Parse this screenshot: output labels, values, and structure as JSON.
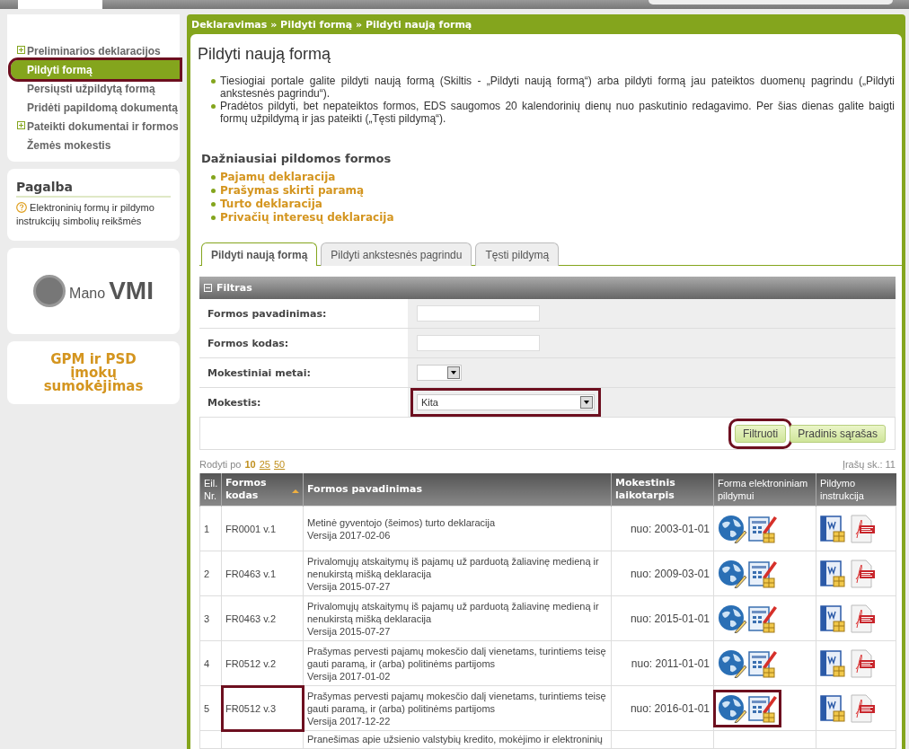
{
  "sidebar": {
    "menu": [
      {
        "label": "Preliminarios deklaracijos",
        "expandable": true,
        "selected": false,
        "marked": false
      },
      {
        "label": "Pildyti formą",
        "expandable": false,
        "selected": true,
        "marked": true
      },
      {
        "label": "Persiųsti užpildytą formą",
        "expandable": false,
        "selected": false,
        "marked": false
      },
      {
        "label": "Pridėti papildomą dokumentą",
        "expandable": false,
        "selected": false,
        "marked": false
      },
      {
        "label": "Pateikti dokumentai ir formos",
        "expandable": true,
        "selected": false,
        "marked": false
      },
      {
        "label": "Žemės mokestis",
        "expandable": false,
        "selected": false,
        "marked": false
      }
    ],
    "help": {
      "title": "Pagalba",
      "link": "Elektroninių formų ir pildymo instrukcijų simbolių reikšmės"
    },
    "logo": {
      "small": "Mano",
      "large": "VMI"
    },
    "promo": "GPM ir PSD įmokų sumokėjimas"
  },
  "breadcrumb": "Deklaravimas » Pildyti formą » Pildyti naują formą",
  "page_title": "Pildyti naują formą",
  "intro": [
    "Tiesiogiai portale galite pildyti naują formą (Skiltis - „Pildyti naują formą“) arba pildyti formą jau pateiktos duomenų pagrindu („Pildyti ankstesnės pagrindu“).",
    "Pradėtos pildyti, bet nepateiktos formos, EDS saugomos 20 kalendorinių dienų nuo paskutinio redagavimo. Per šias dienas galite baigti formų užpildymą ir jas pateikti („Tęsti pildymą“)."
  ],
  "frequent": {
    "title": "Dažniausiai pildomos formos",
    "links": [
      "Pajamų deklaracija",
      "Prašymas skirti paramą",
      "Turto deklaracija",
      "Privačių interesų deklaracija"
    ]
  },
  "tabs": [
    {
      "label": "Pildyti naują formą",
      "selected": true
    },
    {
      "label": "Pildyti ankstesnės pagrindu",
      "selected": false
    },
    {
      "label": "Tęsti pildymą",
      "selected": false
    }
  ],
  "filter": {
    "title": "Filtras",
    "expanded": true,
    "fields": [
      {
        "label": "Formos pavadinimas:",
        "kind": "text",
        "annotated": false
      },
      {
        "label": "Formos kodas:",
        "kind": "text",
        "annotated": false
      },
      {
        "label": "Mokestiniai metai:",
        "kind": "short-select",
        "annotated": false
      },
      {
        "label": "Mokestis:",
        "kind": "select",
        "value": "Kita",
        "annotated": true
      }
    ],
    "buttons": [
      {
        "label": "Filtruoti",
        "marked": true
      },
      {
        "label": "Pradinis sąrašas",
        "marked": false
      }
    ]
  },
  "paging": {
    "label": "Rodyti po",
    "sizes": [
      {
        "label": "10",
        "selected": true
      },
      {
        "label": "25",
        "selected": false
      },
      {
        "label": "50",
        "selected": false
      }
    ],
    "count": "Įrašų sk.: 11"
  },
  "table": {
    "columns": [
      {
        "label": "Eil. Nr.",
        "bold": false,
        "sorted": false
      },
      {
        "label": "Formos kodas",
        "bold": true,
        "sorted": true
      },
      {
        "label": "Formos pavadinimas",
        "bold": true,
        "sorted": false
      },
      {
        "label": "Mokestinis laikotarpis",
        "bold": true,
        "sorted": false
      },
      {
        "label": "Forma elektroniniam pildymui",
        "bold": false,
        "sorted": false
      },
      {
        "label": "Pildymo instrukcija",
        "bold": false,
        "sorted": false
      }
    ],
    "rows": [
      {
        "no": "1",
        "code": "FR0001 v.1",
        "name": "Metinė gyventojo (šeimos) turto deklaracija",
        "version": "Versija 2017-02-06",
        "period": "nuo: 2003-01-01",
        "code_marked": false,
        "icons_marked": false
      },
      {
        "no": "2",
        "code": "FR0463 v.1",
        "name": "Privalomųjų atskaitymų iš pajamų už parduotą žaliavinę medieną ir nenukirstą mišką deklaracija",
        "version": "Versija 2015-07-27",
        "period": "nuo: 2009-03-01",
        "code_marked": false,
        "icons_marked": false
      },
      {
        "no": "3",
        "code": "FR0463 v.2",
        "name": "Privalomųjų atskaitymų iš pajamų už parduotą žaliavinę medieną ir nenukirstą mišką deklaracija",
        "version": "Versija 2015-07-27",
        "period": "nuo: 2015-01-01",
        "code_marked": false,
        "icons_marked": false
      },
      {
        "no": "4",
        "code": "FR0512 v.2",
        "name": "Prašymas pervesti pajamų mokesčio dalį vienetams, turintiems teisę gauti paramą, ir (arba) politinėms partijoms",
        "version": "Versija 2017-01-02",
        "period": "nuo: 2011-01-01",
        "code_marked": false,
        "icons_marked": false
      },
      {
        "no": "5",
        "code": "FR0512 v.3",
        "name": "Prašymas pervesti pajamų mokesčio dalį vienetams, turintiems teisę gauti paramą, ir (arba) politinėms partijoms",
        "version": "Versija 2017-12-22",
        "period": "nuo: 2016-01-01",
        "code_marked": true,
        "icons_marked": true
      }
    ],
    "partial_row": {
      "name": "Pranešimas apie užsienio valstybių kredito, mokėjimo ir elektroninių"
    }
  }
}
